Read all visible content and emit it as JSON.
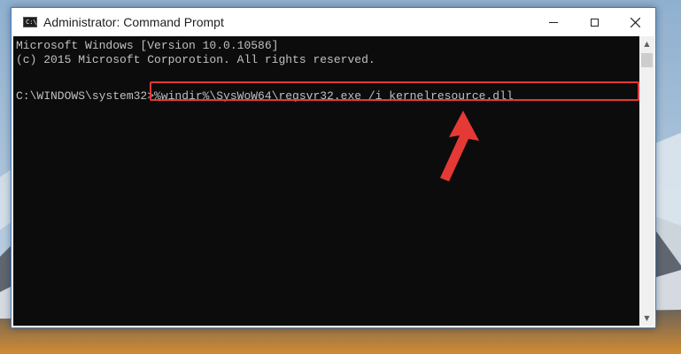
{
  "window": {
    "title": "Administrator: Command Prompt",
    "icon_label": "C:\\",
    "accent_color": "#2e7fd6"
  },
  "console": {
    "lines": [
      "Microsoft Windows [Version 10.0.10586]",
      "(c) 2015 Microsoft Corporotion. All rights reserved.",
      "C:\\WINDOWS\\system32>%windir%\\SysWoW64\\regsvr32.exe /i kernelresource.dll"
    ],
    "background_color": "#0c0c0c",
    "text_color": "#c0c0c0"
  },
  "annotation": {
    "highlight_color": "#e53935",
    "arrow_color": "#e53935"
  },
  "icons": {
    "minimize": "minimize-icon",
    "maximize": "maximize-icon",
    "close": "close-icon",
    "scroll_up": "chevron-up-icon",
    "scroll_down": "chevron-down-icon",
    "app": "command-prompt-icon"
  }
}
